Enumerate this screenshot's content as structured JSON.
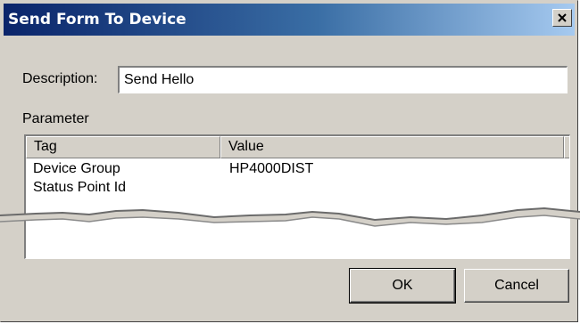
{
  "window": {
    "title": "Send Form To Device"
  },
  "description": {
    "label": "Description:",
    "value": "Send Hello"
  },
  "parameter": {
    "label": "Parameter",
    "columns": [
      "Tag",
      "Value"
    ],
    "rows": [
      {
        "tag": "Device Group",
        "value": "HP4000DIST"
      },
      {
        "tag": "Status Point Id",
        "value": ""
      }
    ]
  },
  "buttons": {
    "ok": "OK",
    "cancel": "Cancel"
  },
  "icons": {
    "close": "close-icon"
  }
}
